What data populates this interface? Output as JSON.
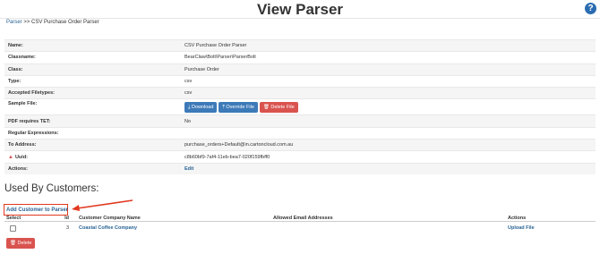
{
  "header": {
    "title": "View Parser",
    "help_glyph": "?"
  },
  "breadcrumb": {
    "link": "Parser",
    "separator": ">>",
    "current": "CSV Purchase Order Parser"
  },
  "details": {
    "name_label": "Name:",
    "name_value": "CSV Purchase Order Parser",
    "classname_label": "Classname:",
    "classname_value": "BearClaw\\Bolt\\Parser\\ParserBolt",
    "class_label": "Class:",
    "class_value": "Purchase Order",
    "type_label": "Type:",
    "type_value": "csv",
    "filetypes_label": "Accepted Filetypes:",
    "filetypes_value": "csv",
    "sample_label": "Sample File:",
    "download_label": "Download",
    "override_label": "Override File",
    "delete_file_label": "Delete File",
    "pdf_label": "PDF requires TET:",
    "pdf_value": "No",
    "regex_label": "Regular Expressions:",
    "to_label": "To Address:",
    "to_value": "purchase_orders+Default@in.cartoncloud.com.au",
    "uuid_label": "Uuid:",
    "uuid_value": "c8b60bf9-7af4-11eb-bea7-020f159fbff0",
    "actions_label": "Actions:",
    "edit_label": "Edit"
  },
  "customers": {
    "heading": "Used By Customers:",
    "add_link": "Add Customer to Parser",
    "columns": {
      "select": "Select",
      "id": "Id",
      "name": "Customer Company Name",
      "email": "Allowed Email Addresses",
      "actions": "Actions"
    },
    "rows": [
      {
        "id": "3",
        "name": "Coastal Coffee Company",
        "email": "",
        "action": "Upload File"
      }
    ],
    "delete_label": "Delete"
  },
  "colors": {
    "primary": "#3d7ab8",
    "danger": "#d9534f",
    "link": "#2a6496",
    "annotation": "#e0391f"
  },
  "icons": [
    "help-icon",
    "download-icon",
    "upload-icon",
    "trash-icon",
    "warning-icon",
    "annotation-arrow"
  ]
}
